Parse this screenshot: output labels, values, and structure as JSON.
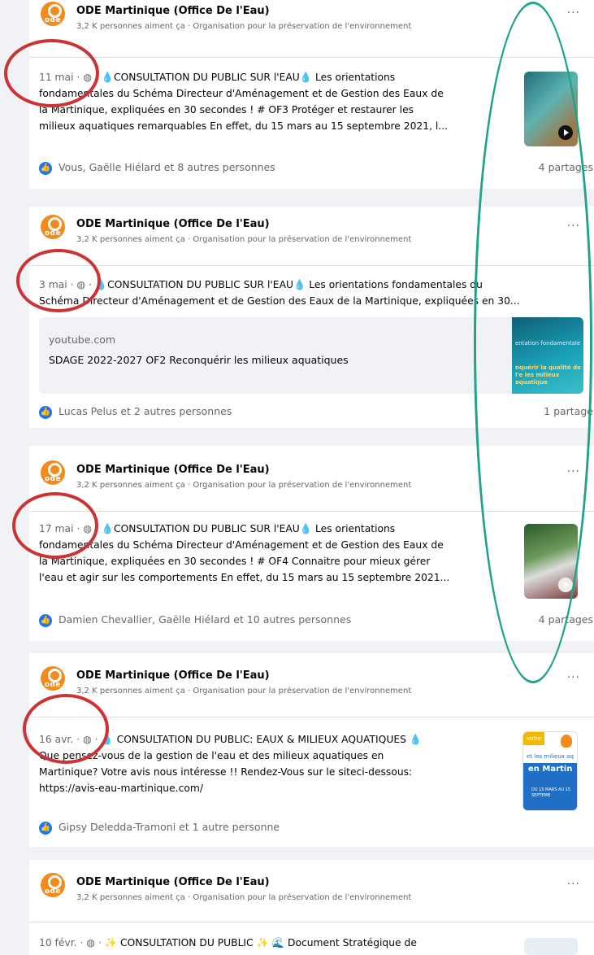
{
  "page_name": "ODE Martinique (Office De l'Eau)",
  "page_subtitle": "3,2 K personnes aiment ça · Organisation pour la préservation de l'environnement",
  "avatar_text": "ode",
  "more_label": "···",
  "globe_sep": " · ◍ · ",
  "posts": [
    {
      "date": "11 mai",
      "lines": [
        "💧CONSULTATION DU PUBLIC SUR l'EAU💧 Les orientations",
        "fondamentales du Schéma Directeur d'Aménagement et de Gestion des Eaux de",
        "la Martinique, expliquées en 30 secondes ! # OF3 Protéger et restaurer les",
        "milieux aquatiques remarquables En effet, du 15 mars au 15 septembre 2021, l..."
      ],
      "reactions": "Vous, Gaëlle Hiélard et 8 autres personnes",
      "shares": "4 partages"
    },
    {
      "date": "3 mai",
      "lines": [
        "💧CONSULTATION DU PUBLIC SUR l'EAU💧 Les orientations fondamentales du",
        "Schéma Directeur d'Aménagement et de Gestion des Eaux de la Martinique, expliquées en 30..."
      ],
      "link_domain": "youtube.com",
      "link_title": "SDAGE 2022-2027 OF2 Reconquérir les milieux aquatiques",
      "link_thumb_text1": "entation fondamentale",
      "link_thumb_text2": "nquérir la qualité de l'e les milieux aquatique",
      "reactions": "Lucas Pelus et 2 autres personnes",
      "shares": "1 partage"
    },
    {
      "date": "17 mai",
      "lines": [
        "💧CONSULTATION DU PUBLIC SUR l'EAU💧 Les orientations",
        "fondamentales du Schéma Directeur d'Aménagement et de Gestion des Eaux de",
        "la Martinique, expliquées en 30 secondes ! # OF4 Connaitre pour mieux gérer",
        "l'eau et agir sur les comportements En effet, du 15 mars au 15 septembre 2021..."
      ],
      "reactions": "Damien Chevallier, Gaëlle Hiélard et 10 autres personnes",
      "shares": "4 partages"
    },
    {
      "date": "16 avr.",
      "lines": [
        "💧 CONSULTATION DU PUBLIC: EAUX & MILIEUX AQUATIQUES 💧",
        "Que pensez-vous de la gestion de l'eau et des milieux aquatiques en",
        "Martinique? Votre avis nous intéresse !! Rendez-Vous sur le siteci-dessous:",
        "https://avis-eau-martinique.com/"
      ],
      "thumb_text1": "votre",
      "thumb_text2": "et les milieux aq",
      "thumb_text3": "en Martin",
      "thumb_text4": "DU 15 MARS AU 15 SEPTEMB",
      "reactions": "Gipsy Deledda-Tramoni et 1 autre personne",
      "shares": ""
    },
    {
      "date": "10 févr.",
      "lines": [
        "✨ CONSULTATION DU PUBLIC ✨ 🌊 Document Stratégique de"
      ],
      "reactions": "",
      "shares": ""
    }
  ],
  "colors": {
    "ode_orange": "#f28b1e",
    "like_blue": "#1877f2",
    "annotation_red": "#cc3333",
    "annotation_green": "#1fa38a"
  }
}
